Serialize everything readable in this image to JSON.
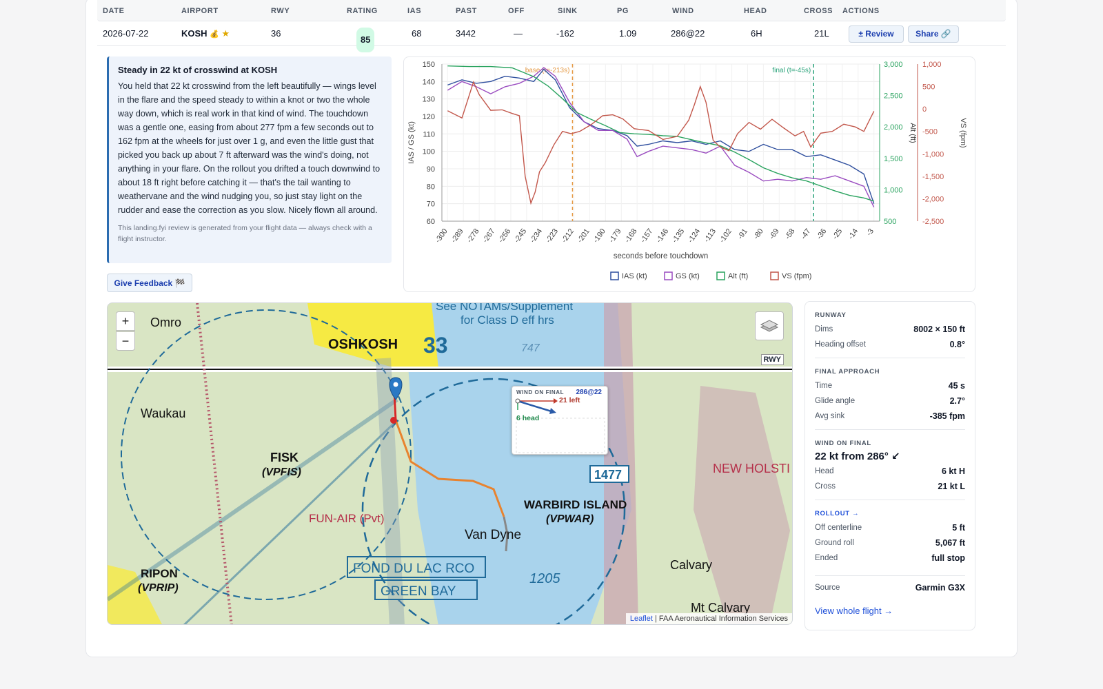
{
  "table": {
    "headers": [
      "DATE",
      "AIRPORT",
      "RWY",
      "RATING",
      "IAS",
      "PAST",
      "OFF",
      "SINK",
      "PG",
      "WIND",
      "HEAD",
      "CROSS",
      "ACTIONS"
    ],
    "row": {
      "date": "2026-07-22",
      "airport": "KOSH",
      "medal": "💰",
      "star": "★",
      "rwy": "36",
      "rating": "85",
      "ias": "68",
      "past": "3442",
      "off": "—",
      "sink": "-162",
      "pg": "1.09",
      "wind": "286@22",
      "head": "6H",
      "cross": "21L",
      "review_label": "± Review",
      "share_label": "Share 🔗"
    }
  },
  "feedback": {
    "title": "Steady in 22 kt of crosswind at KOSH",
    "body": "You held that 22 kt crosswind from the left beautifully — wings level in the flare and the speed steady to within a knot or two the whole way down, which is real work in that kind of wind. The touchdown was a gentle one, easing from about 277 fpm a few seconds out to 162 fpm at the wheels for just over 1 g, and even the little gust that picked you back up about 7 ft afterward was the wind's doing, not anything in your flare. On the rollout you drifted a touch downwind to about 18 ft right before catching it — that's the tail wanting to weathervane and the wind nudging you, so just stay light on the rudder and ease the correction as you slow. Nicely flown all around.",
    "note": "This landing.fyi review is generated from your flight data — always check with a flight instructor.",
    "button": "Give Feedback 🏁"
  },
  "chart_data": {
    "type": "line",
    "xlabel": "seconds before touchdown",
    "x_ticks": [
      -300,
      -289,
      -278,
      -267,
      -256,
      -245,
      -234,
      -223,
      -212,
      -201,
      -190,
      -179,
      -168,
      -157,
      -146,
      -135,
      -124,
      -113,
      -102,
      -91,
      -80,
      -69,
      -58,
      -47,
      -36,
      -25,
      -14,
      -3
    ],
    "xlim": [
      -304,
      1
    ],
    "ylabel_left": "IAS / GS (kt)",
    "ylim_left": [
      60,
      150
    ],
    "yticks_left": [
      60,
      70,
      80,
      90,
      100,
      110,
      120,
      130,
      140,
      150
    ],
    "ylabel_alt": "Alt (ft)",
    "ylim_alt": [
      500,
      3000
    ],
    "yticks_alt": [
      "500",
      "1,000",
      "1,500",
      "2,000",
      "2,500",
      "3,000"
    ],
    "ylabel_vs": "VS (fpm)",
    "ylim_vs": [
      -2500,
      1000
    ],
    "yticks_vs": [
      "-2,500",
      "-2,000",
      "-1,500",
      "-1,000",
      "-500",
      "0",
      "500",
      "1,000"
    ],
    "annotations": [
      {
        "x": -213,
        "label": "base (t=-213s)",
        "color": "#e59a45"
      },
      {
        "x": -45,
        "label": "final (t=-45s)",
        "color": "#2aa37a"
      }
    ],
    "series": [
      {
        "name": "IAS (kt)",
        "axis": "left",
        "color": "#2f4f9e",
        "x": [
          -300,
          -290,
          -280,
          -270,
          -260,
          -250,
          -240,
          -233,
          -225,
          -215,
          -205,
          -195,
          -185,
          -175,
          -168,
          -160,
          -150,
          -140,
          -130,
          -120,
          -110,
          -100,
          -90,
          -80,
          -70,
          -60,
          -50,
          -40,
          -30,
          -20,
          -10,
          -3
        ],
        "y": [
          138,
          141,
          139,
          140,
          143,
          142,
          140,
          147,
          141,
          125,
          117,
          113,
          112,
          109,
          103,
          104,
          106,
          105,
          106,
          104,
          106,
          101,
          100,
          104,
          101,
          101,
          97,
          98,
          95,
          92,
          87,
          70
        ]
      },
      {
        "name": "GS (kt)",
        "axis": "left",
        "color": "#9a4cc0",
        "x": [
          -300,
          -290,
          -280,
          -270,
          -260,
          -250,
          -240,
          -233,
          -225,
          -215,
          -205,
          -195,
          -185,
          -175,
          -168,
          -160,
          -150,
          -140,
          -130,
          -120,
          -110,
          -100,
          -90,
          -80,
          -70,
          -60,
          -50,
          -40,
          -30,
          -20,
          -10,
          -3
        ],
        "y": [
          135,
          140,
          137,
          133,
          137,
          139,
          143,
          148,
          143,
          128,
          117,
          112,
          112,
          107,
          97,
          100,
          103,
          102,
          101,
          99,
          103,
          92,
          88,
          83,
          84,
          83,
          85,
          84,
          86,
          83,
          80,
          68
        ]
      },
      {
        "name": "Alt (ft)",
        "axis": "alt",
        "color": "#2aa35f",
        "x": [
          -300,
          -285,
          -270,
          -255,
          -240,
          -230,
          -220,
          -210,
          -200,
          -190,
          -180,
          -170,
          -160,
          -150,
          -140,
          -125,
          -110,
          -100,
          -90,
          -80,
          -70,
          -60,
          -50,
          -40,
          -30,
          -20,
          -10,
          -3
        ],
        "y": [
          2970,
          2960,
          2960,
          2940,
          2800,
          2650,
          2450,
          2230,
          2120,
          2020,
          1910,
          1890,
          1880,
          1860,
          1850,
          1770,
          1700,
          1600,
          1480,
          1350,
          1260,
          1190,
          1140,
          1060,
          980,
          910,
          870,
          820
        ]
      },
      {
        "name": "VS (fpm)",
        "axis": "vs",
        "color": "#c2574b",
        "x": [
          -300,
          -290,
          -282,
          -278,
          -270,
          -262,
          -255,
          -250,
          -246,
          -242,
          -239,
          -236,
          -232,
          -226,
          -220,
          -214,
          -208,
          -200,
          -192,
          -185,
          -178,
          -170,
          -160,
          -150,
          -140,
          -132,
          -128,
          -124,
          -120,
          -115,
          -110,
          -104,
          -98,
          -90,
          -82,
          -74,
          -66,
          -58,
          -52,
          -47,
          -40,
          -32,
          -24,
          -16,
          -10,
          -3
        ],
        "y": [
          -40,
          -200,
          600,
          320,
          -30,
          -20,
          -100,
          -150,
          -1500,
          -2100,
          -1850,
          -1400,
          -1200,
          -800,
          -500,
          -550,
          -500,
          -350,
          -150,
          -130,
          -220,
          -440,
          -480,
          -680,
          -610,
          -250,
          100,
          500,
          150,
          -700,
          -850,
          -930,
          -550,
          -300,
          -450,
          -230,
          -420,
          -600,
          -500,
          -850,
          -540,
          -500,
          -340,
          -400,
          -500,
          -50
        ]
      }
    ]
  },
  "map": {
    "zoom_in": "+",
    "zoom_out": "−",
    "rwy_label": "RWY",
    "attribution_leaflet": "Leaflet",
    "attribution_rest": " | FAA Aeronautical Information Services",
    "labels": [
      "OSHKOSH",
      "33",
      "Omro",
      "Waukau",
      "FISK",
      "(VPFIS)",
      "WARBIRD ISLAND",
      "(VPWAR)",
      "FUN-AIR (Pvt)",
      "Van Dyne",
      "RIPON",
      "(VPRIP)",
      "FOND DU LAC RCO",
      "GREEN BAY",
      "Calvary",
      "Mt Calvary",
      "NEW HOLSTI",
      "See NOTAMs/Supplement",
      "for Class D eff hrs",
      "1205",
      "1477",
      "747"
    ],
    "wind_popup": {
      "title": "WIND ON FINAL",
      "value": "286@22",
      "cross": "21 left",
      "head": "6 head"
    }
  },
  "side": {
    "runway_title": "RUNWAY",
    "dims_label": "Dims",
    "dims": "8002 × 150 ft",
    "heading_offset_label": "Heading offset",
    "heading_offset": "0.8°",
    "final_title": "FINAL APPROACH",
    "time_label": "Time",
    "time": "45 s",
    "glide_label": "Glide angle",
    "glide": "2.7°",
    "avgsink_label": "Avg sink",
    "avgsink": "-385 fpm",
    "wind_title": "WIND ON FINAL",
    "wind_big": "22 kt from 286° ↙",
    "head_label": "Head",
    "head": "6 kt H",
    "cross_label": "Cross",
    "cross": "21 kt L",
    "rollout_title": "ROLLOUT →",
    "offcl_label": "Off centerline",
    "offcl": "5 ft",
    "roll_label": "Ground roll",
    "roll": "5,067 ft",
    "ended_label": "Ended",
    "ended": "full stop",
    "source_label": "Source",
    "source": "Garmin G3X",
    "view_link": "View whole flight →"
  },
  "colors": {
    "accent": "#1d4ed8",
    "badge_bg": "#d1fae5",
    "feedback_bg": "#eef3fb"
  }
}
